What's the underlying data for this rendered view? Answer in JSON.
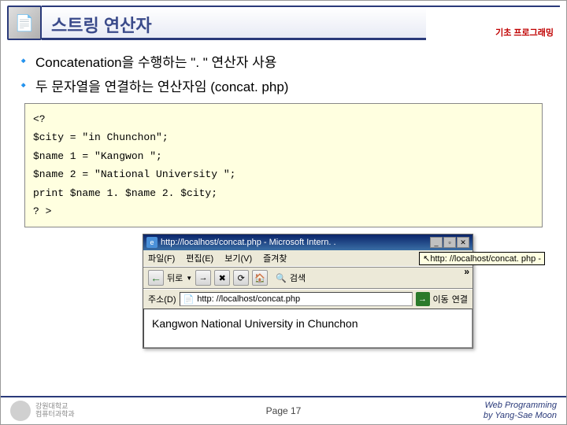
{
  "header": {
    "title": "스트링 연산자",
    "subtitle": "기초 프로그래밍"
  },
  "bullets": [
    "Concatenation을 수행하는 \". \" 연산자 사용",
    "두 문자열을 연결하는 연산자임 (concat. php)"
  ],
  "code": {
    "l1": "<?",
    "l2": "$city = \"in Chunchon\";",
    "l3": "$name 1 = \"Kangwon \";",
    "l4": "$name 2 = \"National University \";",
    "l5": "print $name 1. $name 2. $city;",
    "l6": "? >"
  },
  "ie": {
    "title": "http://localhost/concat.php - Microsoft Intern. .",
    "min": "_",
    "max": "▫",
    "close": "✕",
    "menu": {
      "file": "파일(F)",
      "edit": "편집(E)",
      "view": "보기(V)",
      "fav": "즐겨찾"
    },
    "tooltip": "http: //localhost/concat. php -",
    "toolbar": {
      "back": "뒤로",
      "search": "검색"
    },
    "addr": {
      "label": "주소(D)",
      "value": "http: //localhost/concat.php",
      "go": "이동",
      "link": "연결"
    },
    "body": "Kangwon National University in Chunchon",
    "chevron": "»"
  },
  "footer": {
    "page": "Page 17",
    "credit1": "Web Programming",
    "credit2": "by Yang-Sae Moon"
  }
}
